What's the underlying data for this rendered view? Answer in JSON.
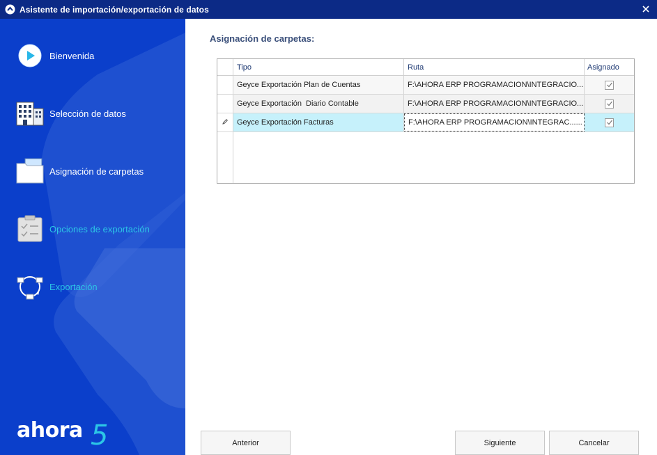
{
  "window": {
    "title": "Asistente de importación/exportación de datos"
  },
  "sidebar": {
    "steps": [
      {
        "label": "Bienvenida",
        "icon": "play-icon",
        "enabled": true
      },
      {
        "label": "Selección de datos",
        "icon": "building-icon",
        "enabled": true
      },
      {
        "label": "Asignación de carpetas",
        "icon": "folder-icon",
        "enabled": true
      },
      {
        "label": "Opciones de exportación",
        "icon": "clipboard-checklist-icon",
        "enabled": false
      },
      {
        "label": "Exportación",
        "icon": "sync-cycle-icon",
        "enabled": false
      }
    ],
    "logo": {
      "text": "ahora",
      "version": "5"
    }
  },
  "main": {
    "section_title": "Asignación de carpetas:",
    "grid": {
      "columns": [
        "Tipo",
        "Ruta",
        "Asignado"
      ],
      "rows": [
        {
          "tipo": "Geyce Exportación Plan de Cuentas",
          "ruta": "F:\\AHORA ERP PROGRAMACION\\INTEGRACIO...",
          "asignado": true,
          "selected": false
        },
        {
          "tipo": "Geyce Exportación  Diario Contable",
          "ruta": "F:\\AHORA ERP PROGRAMACION\\INTEGRACIO...",
          "asignado": true,
          "selected": false
        },
        {
          "tipo": "Geyce Exportación Facturas",
          "ruta": "F:\\AHORA ERP PROGRAMACION\\INTEGRAC...",
          "asignado": true,
          "selected": true
        }
      ],
      "edit_button": "..."
    }
  },
  "buttons": {
    "previous": "Anterior",
    "next": "Siguiente",
    "cancel": "Cancelar"
  },
  "colors": {
    "titlebar": "#0c2a86",
    "sidebar": "#0b3fcb",
    "disabled_step": "#2cc6e6",
    "selected_row": "#c6f1fb"
  }
}
